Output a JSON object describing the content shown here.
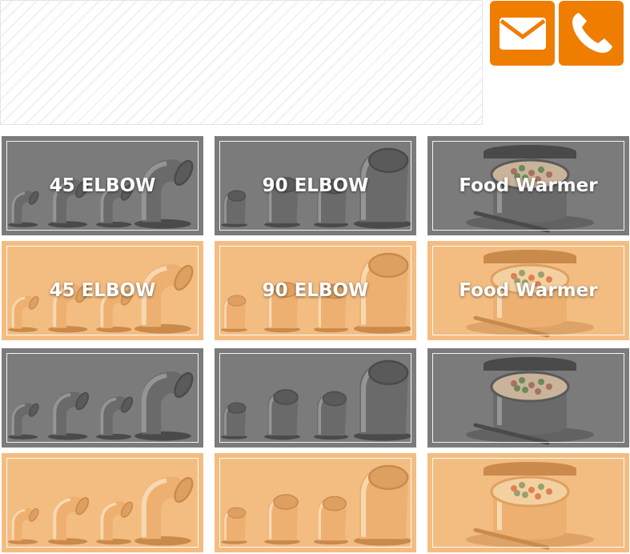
{
  "header": {
    "email_icon": "envelope-icon",
    "phone_icon": "phone-icon",
    "accent_color": "#ef7d00"
  },
  "colors": {
    "gray_tile": "#7b7b7b",
    "orange_tile": "#f3bd82"
  },
  "rows": [
    {
      "theme": "gray",
      "tiles": [
        {
          "kind": "elbow45",
          "label": "45 ELBOW"
        },
        {
          "kind": "elbow90",
          "label": "90 ELBOW"
        },
        {
          "kind": "warmer",
          "label": "Food Warmer"
        }
      ]
    },
    {
      "theme": "orange",
      "tiles": [
        {
          "kind": "elbow45",
          "label": "45 ELBOW"
        },
        {
          "kind": "elbow90",
          "label": "90 ELBOW"
        },
        {
          "kind": "warmer",
          "label": "Food Warmer"
        }
      ]
    },
    {
      "theme": "gray",
      "tiles": [
        {
          "kind": "elbow45",
          "label": ""
        },
        {
          "kind": "elbow90",
          "label": ""
        },
        {
          "kind": "warmer",
          "label": ""
        }
      ]
    },
    {
      "theme": "orange",
      "tiles": [
        {
          "kind": "elbow45",
          "label": ""
        },
        {
          "kind": "elbow90",
          "label": ""
        },
        {
          "kind": "warmer",
          "label": ""
        }
      ]
    }
  ]
}
